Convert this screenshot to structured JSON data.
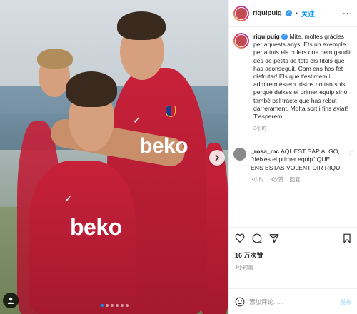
{
  "post": {
    "username": "riquipuig",
    "follow_label": "关注",
    "more_label": "···",
    "separator": "•",
    "caption": "Mite, moltes gràcies per aquests anys. Ets un exemple per a tots els culers que hem gaudit des de petits de tots els títols que has aconseguit. Com ens has fet disfrutar! Els que t'estimem i admirem estem tristos no tan sols perquè deixes el primer equip sinó també pel tracte que has rebut darrerament. Molta sort i fins aviat! T'esperem.",
    "caption_time": "3小时",
    "comment": {
      "username": "_rosa_mc",
      "text": "AQUEST SAP ALGO, \"deixes el primer equip\" QUE ENS ESTAS VOLENT DIR RIQUI",
      "time": "3小时",
      "likes": "3次赞",
      "reply": "回复"
    },
    "likes": "16 万次赞",
    "posted_ago": "3小时前",
    "comment_placeholder": "添加评论......",
    "post_label": "发布"
  },
  "photo": {
    "jersey_brand": "beko",
    "nike_glyph": "✓"
  },
  "carousel": {
    "count": 6,
    "active_index": 0
  },
  "colors": {
    "accent": "#0095f6",
    "shirt": "#c8213a",
    "verified": "#3897f0"
  },
  "icons": [
    "heart-icon",
    "comment-icon",
    "share-icon",
    "bookmark-icon",
    "emoji-icon",
    "user-tag-icon",
    "next-arrow-icon",
    "more-icon",
    "verified-icon"
  ]
}
